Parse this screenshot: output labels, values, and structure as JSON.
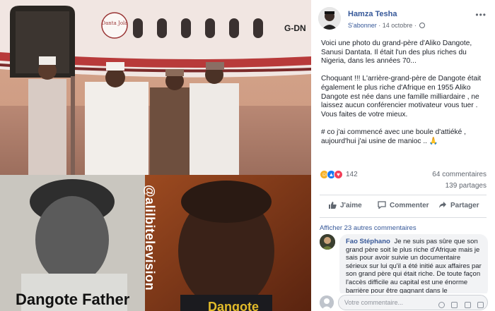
{
  "photo": {
    "caption_left": "Dangote Father",
    "caption_right": "Dangote",
    "watermark": "@alilbitelevision",
    "plane_logo": "Danta Jola",
    "plane_reg": "G-DN"
  },
  "post": {
    "author": "Hamza Tesha",
    "follow_label": "S'abonner",
    "date": "14 octobre",
    "paragraphs": [
      "Voici une photo du grand-père d'Aliko Dangote, Sanusi Dantata. Il était l'un des plus riches du Nigeria, dans les années 70...",
      "Choquant !!! L'arrière-grand-père de Dangote était également le plus riche d'Afrique en 1955 Aliko Dangote est née dans une famille milliardaire , ne laissez aucun conférencier motivateur vous tuer . Vous faites de votre mieux.",
      "# co j'ai commencé avec une boule d'attiéké , aujourd'hui j'ai usine de manioc .. 🙏"
    ],
    "reaction_count": "142",
    "comments_count": "64 commentaires",
    "shares_count": "139 partages"
  },
  "actions": {
    "like": "J'aime",
    "comment": "Commenter",
    "share": "Partager"
  },
  "comments": {
    "more_label": "Afficher 23 autres commentaires",
    "items": [
      {
        "author": "Fao Stéphano",
        "text": "Je ne suis pas sûre que son grand père soit le plus riche d'Afrique mais je sais pour avoir suivie un documentaire sérieux sur lui qu'il a été initié aux affaires par son grand père qui était riche. De toute façon l'accès difficile au capital est une énorme barrière pour être gagnant dans le"
      }
    ]
  },
  "composer": {
    "placeholder": "Votre commentaire..."
  },
  "colors": {
    "link": "#365899",
    "like_blue": "#1877f2",
    "love_red": "#f33e58",
    "haha_yellow": "#f7b125",
    "caption_gold": "#e2bb2a"
  }
}
